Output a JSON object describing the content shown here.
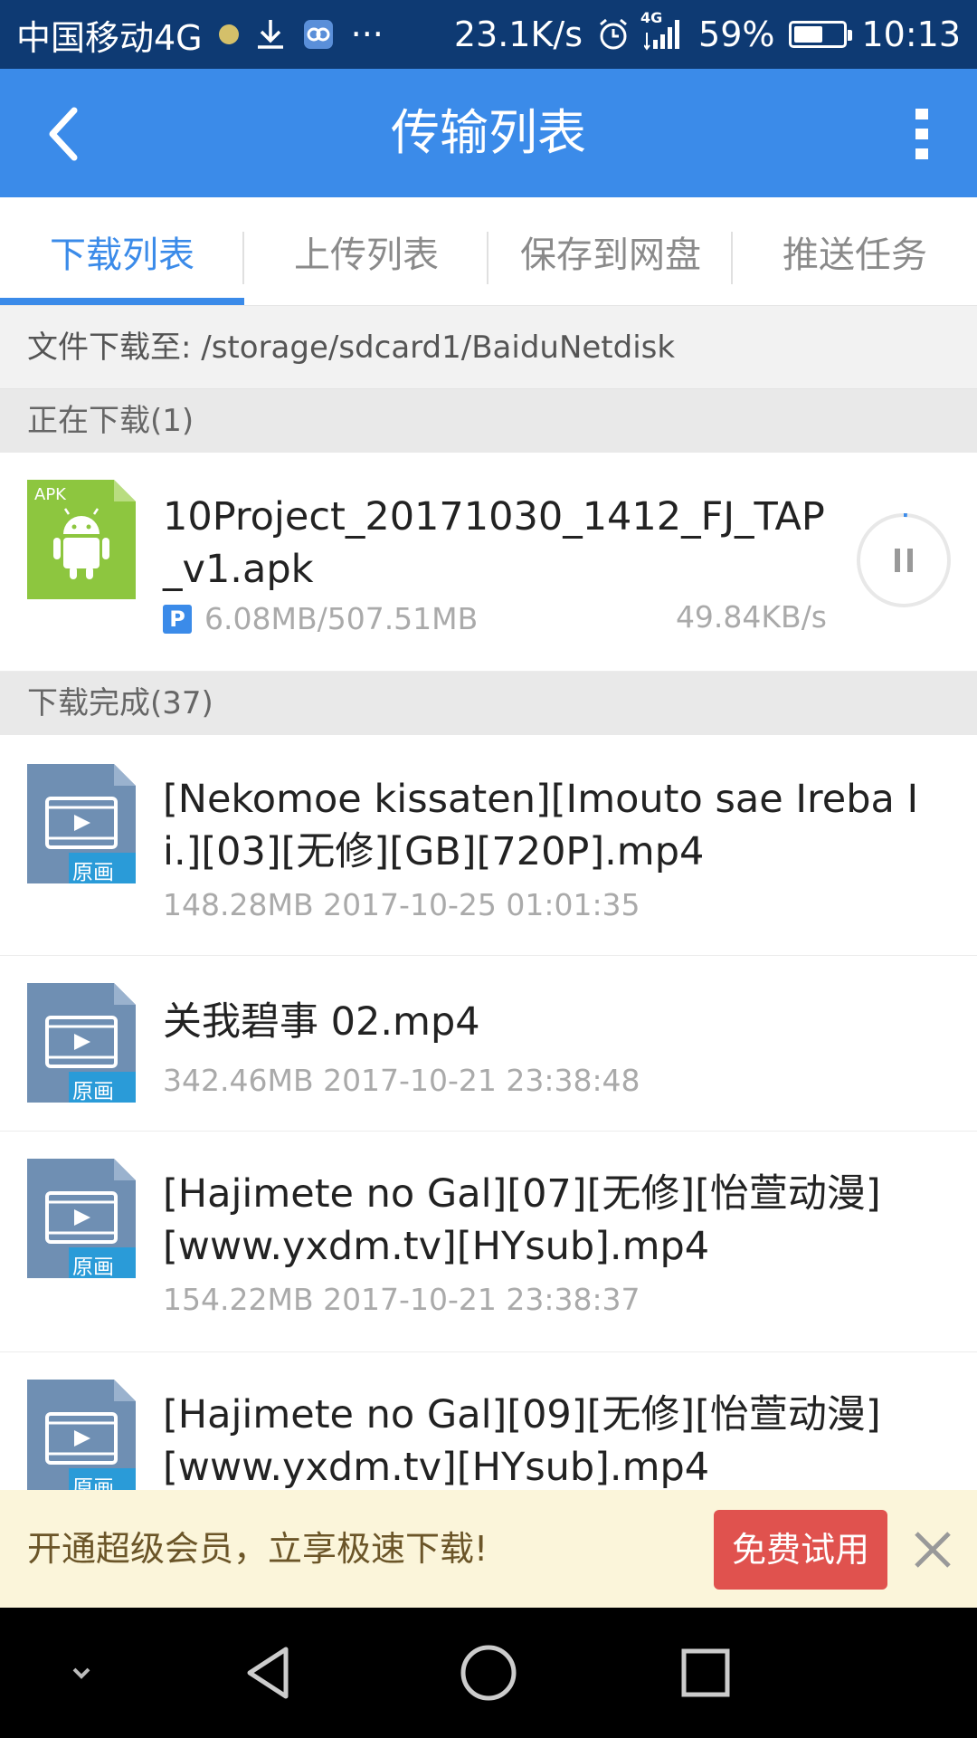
{
  "status_bar": {
    "carrier": "中国移动4G",
    "more": "···",
    "speed": "23.1K/s",
    "network": "4G",
    "battery": "59%",
    "battery_level": 0.59,
    "time": "10:13"
  },
  "app_bar": {
    "title": "传输列表"
  },
  "tabs": [
    {
      "label": "下载列表",
      "active": true
    },
    {
      "label": "上传列表",
      "active": false
    },
    {
      "label": "保存到网盘",
      "active": false
    },
    {
      "label": "推送任务",
      "active": false
    }
  ],
  "path": {
    "label": "文件下载至: /storage/sdcard1/BaiduNetdisk"
  },
  "downloading": {
    "header": "正在下载(1)",
    "items": [
      {
        "icon_label": "APK",
        "name": "10Project_20171030_1412_FJ_TAP_v1.apk",
        "badge": "P",
        "progress": "6.08MB/507.51MB",
        "progress_fraction": 0.012,
        "rate": "49.84KB/s"
      }
    ]
  },
  "completed": {
    "header": "下载完成(37)",
    "items": [
      {
        "name": "[Nekomoe kissaten][Imouto sae Ireba Ii.][03][无修][GB][720P].mp4",
        "meta": "148.28MB 2017-10-25 01:01:35",
        "tag": "原画"
      },
      {
        "name": "关我碧事 02.mp4",
        "meta": "342.46MB 2017-10-21 23:38:48",
        "tag": "原画"
      },
      {
        "name": "[Hajimete no Gal][07][无修][怡萱动漫][www.yxdm.tv][HYsub].mp4",
        "meta": "154.22MB 2017-10-21 23:38:37",
        "tag": "原画"
      },
      {
        "name": "[Hajimete no Gal][09][无修][怡萱动漫][www.yxdm.tv][HYsub].mp4",
        "meta": "",
        "tag": "原画"
      }
    ]
  },
  "promo": {
    "text": "开通超级会员，立享极速下载!",
    "button": "免费试用"
  },
  "colors": {
    "accent": "#3b8be9",
    "status_bar": "#0e3a73",
    "promo_button": "#e0524e",
    "apk_green": "#8dc63f",
    "video_icon": "#6f8fb3"
  }
}
